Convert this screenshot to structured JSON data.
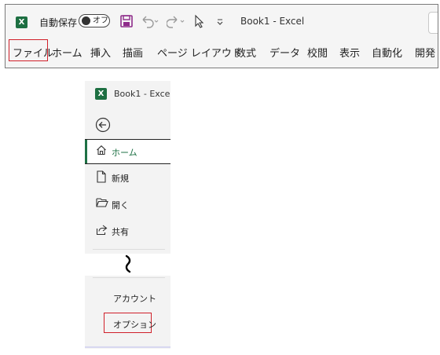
{
  "window": {
    "title": "Book1  -  Excel",
    "autosave_label": "自動保存",
    "autosave_state": "オフ",
    "logo_letter": "X"
  },
  "ribbon": {
    "tabs": [
      "ファイル",
      "ホーム",
      "挿入",
      "描画",
      "ページ レイアウト",
      "数式",
      "データ",
      "校閲",
      "表示",
      "自動化",
      "開発"
    ]
  },
  "backstage": {
    "title": "Book1  -  Exce",
    "items": {
      "home": "ホーム",
      "new": "新規",
      "open": "開く",
      "share": "共有",
      "account": "アカウント",
      "options": "オプション"
    }
  },
  "colors": {
    "excel_green": "#1e7145",
    "highlight_red": "#d0202a",
    "save_icon": "#8e2c8a"
  },
  "icons": [
    "excel-logo-icon",
    "save-icon",
    "undo-icon",
    "redo-icon",
    "pointer-icon",
    "customize-icon",
    "back-arrow-icon",
    "home-icon",
    "new-doc-icon",
    "folder-icon",
    "share-icon",
    "break-squiggle-icon"
  ]
}
